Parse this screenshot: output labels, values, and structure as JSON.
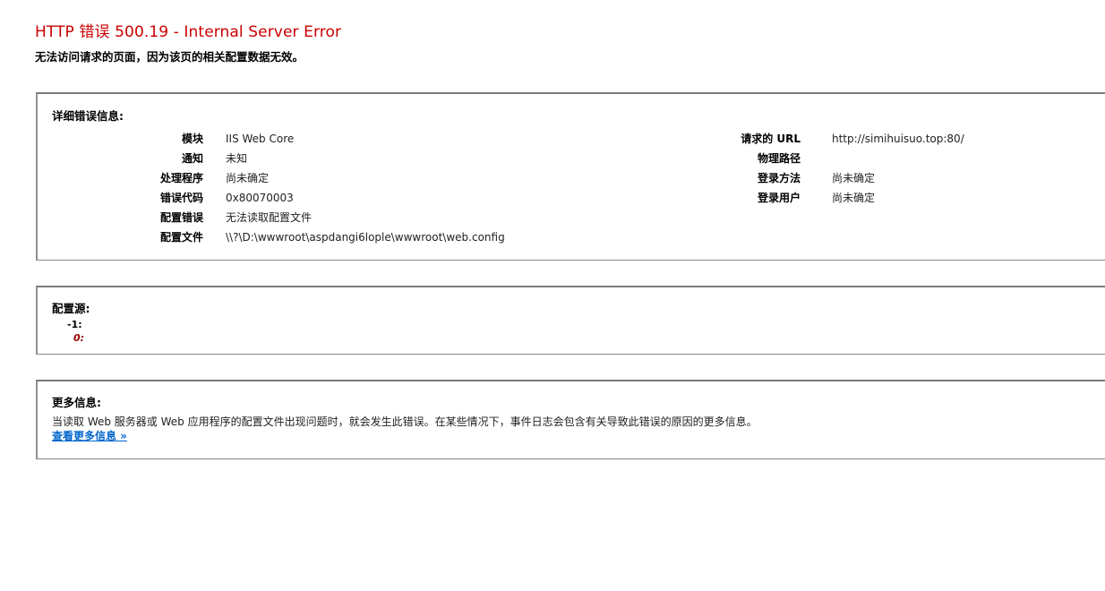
{
  "header": {
    "title": "HTTP 错误 500.19 - Internal Server Error",
    "subtitle": "无法访问请求的页面，因为该页的相关配置数据无效。"
  },
  "detail": {
    "heading": "详细错误信息:",
    "left": [
      {
        "label": "模块",
        "value": "IIS Web Core"
      },
      {
        "label": "通知",
        "value": "未知"
      },
      {
        "label": "处理程序",
        "value": "尚未确定"
      },
      {
        "label": "错误代码",
        "value": "0x80070003"
      },
      {
        "label": "配置错误",
        "value": "无法读取配置文件"
      },
      {
        "label": "配置文件",
        "value": "\\\\?\\D:\\wwwroot\\aspdangi6lople\\wwwroot\\web.config"
      }
    ],
    "right": [
      {
        "label": "请求的 URL",
        "value": "http://simihuisuo.top:80/"
      },
      {
        "label": "物理路径",
        "value": ""
      },
      {
        "label": "登录方法",
        "value": "尚未确定"
      },
      {
        "label": "登录用户",
        "value": "尚未确定"
      }
    ]
  },
  "source": {
    "heading": "配置源:",
    "line_num": "-1:",
    "line_zero": "0:"
  },
  "more": {
    "heading": "更多信息:",
    "text": "当读取 Web 服务器或 Web 应用程序的配置文件出现问题时，就会发生此错误。在某些情况下，事件日志会包含有关导致此错误的原因的更多信息。",
    "link": "查看更多信息 »"
  },
  "colors": {
    "title": "#cc0000",
    "link": "#0066cc",
    "source_zero": "#990000"
  }
}
